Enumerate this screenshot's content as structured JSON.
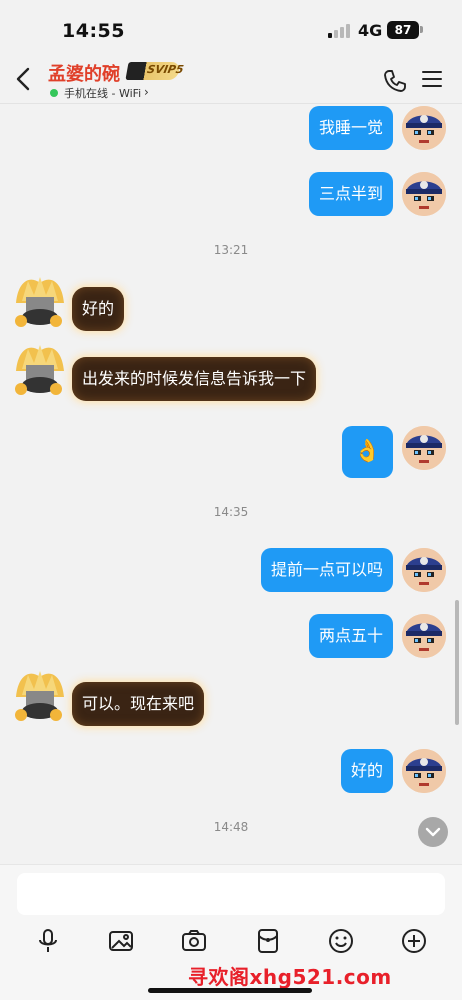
{
  "status_bar": {
    "time": "14:55",
    "network": "4G",
    "battery": "87"
  },
  "header": {
    "contact_name": "孟婆的碗",
    "vip_badge": "SVIP5",
    "online_status": "手机在线 - WiFi",
    "icons": {
      "back": "chevron-left-icon",
      "call": "phone-icon",
      "menu": "menu-icon"
    }
  },
  "messages": [
    {
      "side": "right",
      "text": "我睡一觉"
    },
    {
      "side": "right",
      "text": "三点半到"
    },
    {
      "type": "timestamp",
      "text": "13:21"
    },
    {
      "side": "left",
      "text": "好的"
    },
    {
      "side": "left",
      "text": "出发来的时候发信息告诉我一下"
    },
    {
      "side": "right",
      "text": "👌"
    },
    {
      "type": "timestamp",
      "text": "14:35"
    },
    {
      "side": "right",
      "text": "提前一点可以吗"
    },
    {
      "side": "right",
      "text": "两点五十"
    },
    {
      "side": "left",
      "text": "可以。现在来吧"
    },
    {
      "side": "right",
      "text": "好的"
    },
    {
      "type": "timestamp",
      "text": "14:48"
    }
  ],
  "input": {
    "placeholder": ""
  },
  "toolbar": [
    "mic-icon",
    "image-icon",
    "camera-icon",
    "red-packet-icon",
    "emoji-icon",
    "plus-icon"
  ],
  "watermark": "寻欢阁xhg521.com",
  "colors": {
    "my_bubble": "#1f9af5",
    "their_bubble": "#3a2414",
    "name": "#e0402a",
    "online": "#35c65a"
  }
}
